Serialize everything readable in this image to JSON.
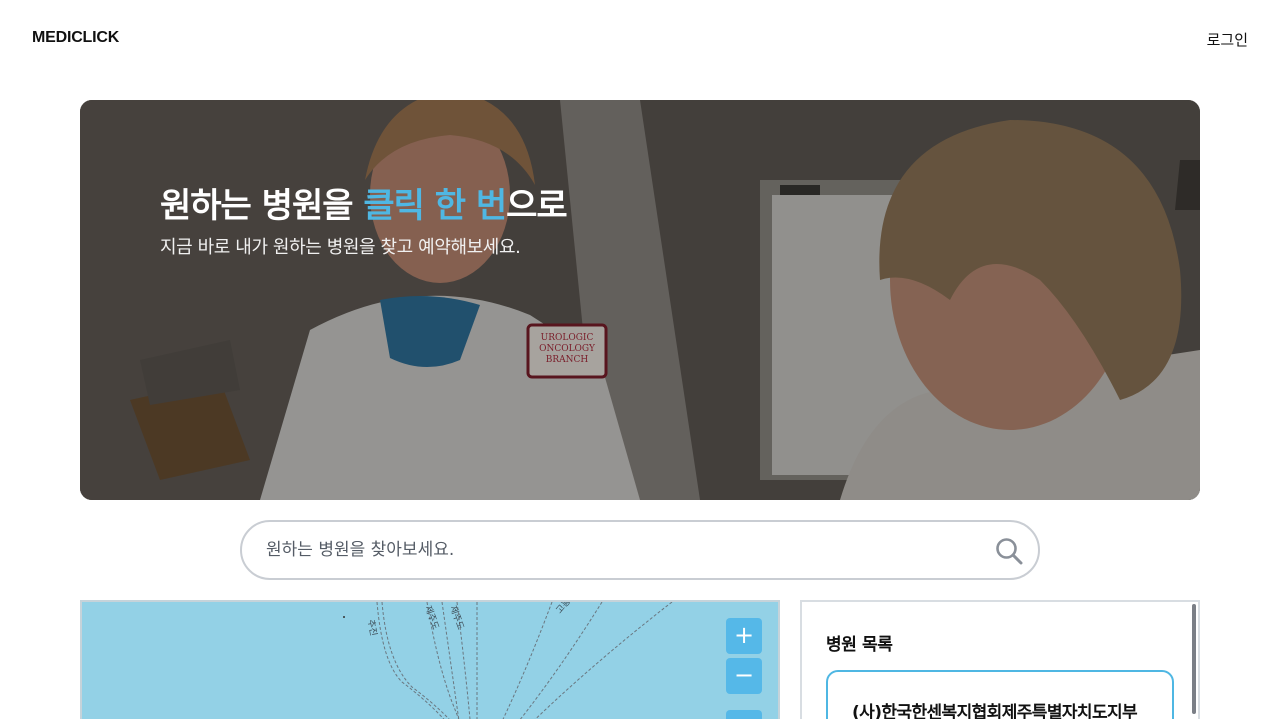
{
  "header": {
    "logo": "MEDICLICK",
    "login_label": "로그인"
  },
  "hero": {
    "title_part1": "원하는 병원을 ",
    "title_accent": "클릭 한 번",
    "title_part2": "으로",
    "subtitle": "지금 바로 내가 원하는 병원을 찾고 예약해보세요.",
    "badge_text": [
      "UROLOGIC",
      "ONCOLOGY",
      "BRANCH"
    ]
  },
  "search": {
    "placeholder": "원하는 병원을 찾아보세요.",
    "value": "",
    "icon": "search-icon"
  },
  "map": {
    "zoom_in_label": "+",
    "zoom_out_label": "−",
    "route_labels": [
      "추진",
      "제주도",
      "제주도",
      "고흥"
    ]
  },
  "hospital_list": {
    "title": "병원 목록",
    "items": [
      {
        "name": "(사)한국한센복지협회제주특별자치도지부"
      }
    ]
  },
  "colors": {
    "accent": "#4fb7e3",
    "map_water": "#93d1e6",
    "zoom_button": "#55b8e8"
  }
}
